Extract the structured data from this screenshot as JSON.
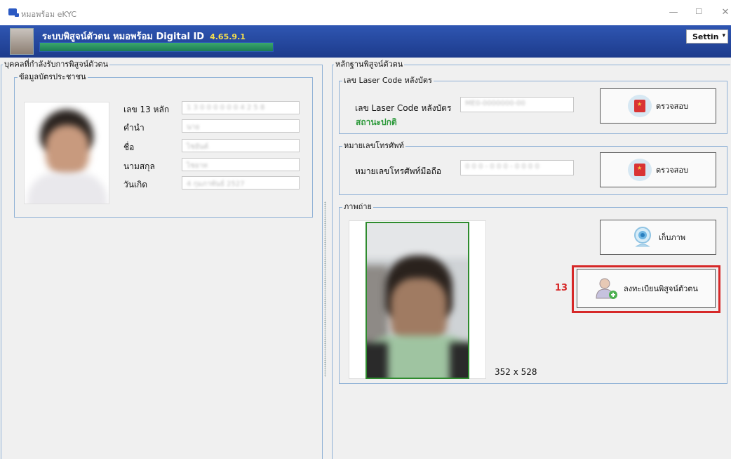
{
  "window": {
    "title": "หมอพร้อม eKYC",
    "minimize": "—",
    "maximize": "☐",
    "close": "✕"
  },
  "header": {
    "app_name": "ระบบพิสูจน์ตัวตน หมอพร้อม Digital ID",
    "version": "4.65.9.1",
    "settings_label": "Settin",
    "settings_caret": "▾",
    "progress_fraction": 1.0
  },
  "left": {
    "group_title": "บุคคลที่กำลังรับการพิสูจน์ตัวตน",
    "card_group_title": "ข้อมูลบัตรประชาชน",
    "fields": [
      {
        "label": "เลข 13 หลัก",
        "value": "1 3 0 0 0 0 0 0 4 2 5 8"
      },
      {
        "label": "คำนำ",
        "value": "นาย"
      },
      {
        "label": "ชื่อ",
        "value": "ไชยันต์"
      },
      {
        "label": "นามสกุล",
        "value": "ไชยาท"
      },
      {
        "label": "วันเกิด",
        "value": "4 กุมภาพันธ์ 2527"
      }
    ]
  },
  "right": {
    "group_title": "หลักฐานพิสูจน์ตัวตน",
    "laser": {
      "group_title": "เลข Laser Code หลังบัตร",
      "label": "เลข Laser Code หลังบัตร",
      "value": "ME0-0000000-00",
      "status": "สถานะปกติ",
      "button": "ตรวจสอบ"
    },
    "phone": {
      "group_title": "หมายเลขโทรศัพท์",
      "label": "หมายเลขโทรศัพท์มือถือ",
      "value": "0 0 0 - 0 0 0 - 0 0 0 0",
      "button": "ตรวจสอบ"
    },
    "photo": {
      "group_title": "ภาพถ่าย",
      "capture_button": "เก็บภาพ",
      "register_button": "ลงทะเบียนพิสูจน์ตัวตน",
      "step_marker": "13",
      "size_text": "352 x 528"
    }
  },
  "colors": {
    "header_blue": "#1d3b8c",
    "version_yellow": "#f6e04c",
    "status_green": "#2e9a3c",
    "highlight_red": "#d62828",
    "group_border": "#8fb1d6",
    "photo_border": "#2e8b2e"
  },
  "icons": [
    "app-icon",
    "ribbon-badge-icon",
    "webcam-icon",
    "user-add-icon"
  ]
}
